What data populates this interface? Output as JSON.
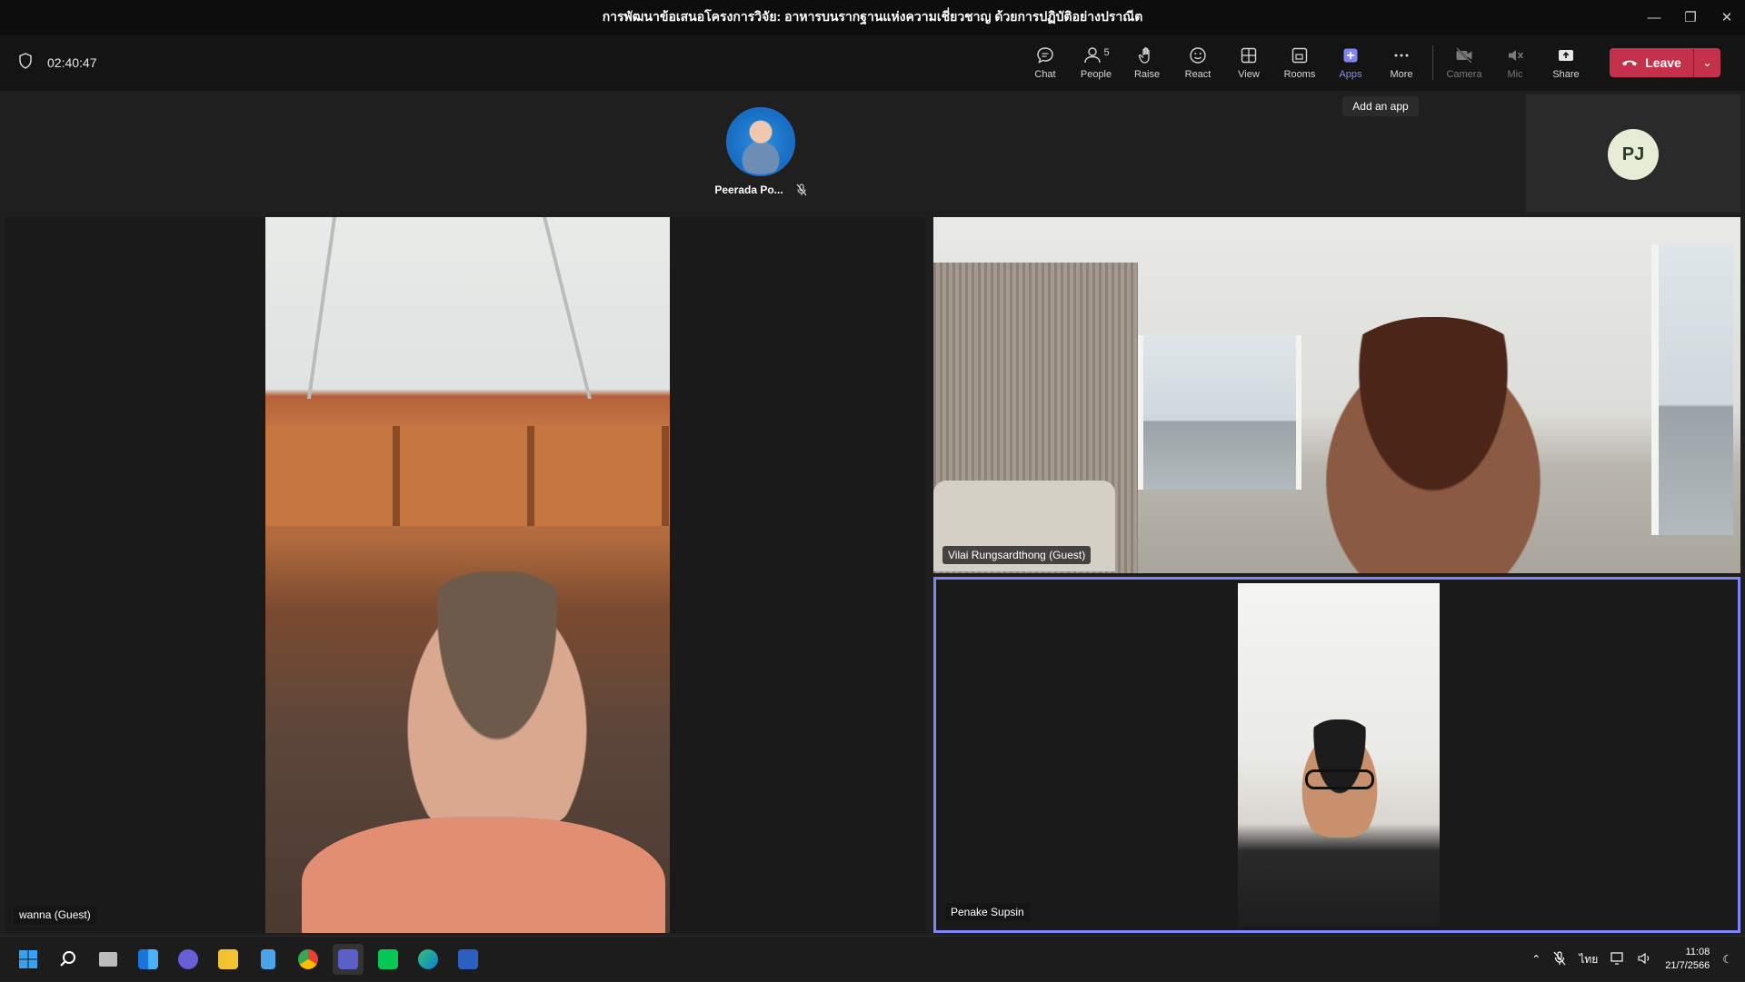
{
  "window": {
    "title": "การพัฒนาข้อเสนอโครงการวิจัย: อาหารบนรากฐานแห่งความเชี่ยวชาญ ด้วยการปฏิบัติอย่างปราณีต"
  },
  "meeting": {
    "timer": "02:40:47"
  },
  "toolbar": {
    "chat": "Chat",
    "people": "People",
    "people_count": "5",
    "raise": "Raise",
    "react": "React",
    "view": "View",
    "rooms": "Rooms",
    "apps": "Apps",
    "more": "More",
    "camera": "Camera",
    "mic": "Mic",
    "share": "Share",
    "leave": "Leave"
  },
  "tooltip": {
    "text": "Add an app"
  },
  "self_view": {
    "initials": "PJ"
  },
  "participants": {
    "top": {
      "name": "Peerada Po..."
    },
    "left": {
      "name": "wanna (Guest)"
    },
    "right_top": {
      "name": "Vilai Rungsardthong (Guest)"
    },
    "right_bottom": {
      "name": "Penake Supsin"
    }
  },
  "taskbar": {
    "lang": "ไทย",
    "time": "11:08",
    "date": "21/7/2566"
  },
  "colors": {
    "leave": "#c4314b",
    "active_accent": "#8d8fd9",
    "speaker_border": "#7f85f5"
  }
}
